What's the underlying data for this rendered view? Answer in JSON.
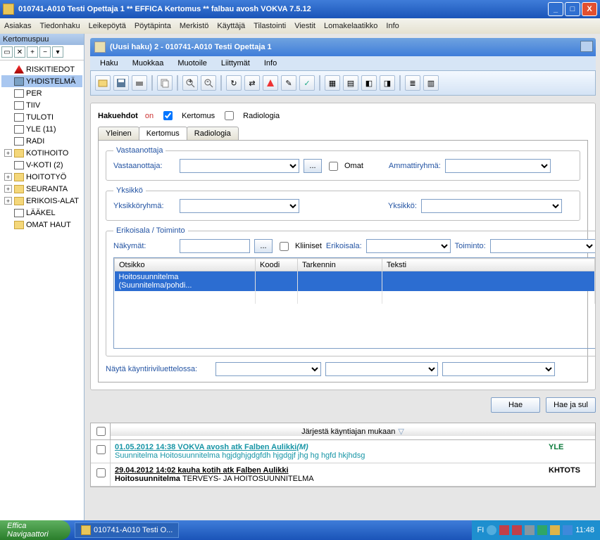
{
  "window_title": "010741-A010 Testi Opettaja 1  ** EFFICA Kertomus **  falbau avosh  VOKVA  7.5.12",
  "main_menu": [
    "Asiakas",
    "Tiedonhaku",
    "Leikepöytä",
    "Pöytäpinta",
    "Merkistö",
    "Käyttäjä",
    "Tilastointi",
    "Viestit",
    "Lomakelaatikko",
    "Info"
  ],
  "tree_header": "Kertomuspuu",
  "tree": [
    {
      "icon": "warn",
      "label": "RISKITIEDOT"
    },
    {
      "icon": "bin",
      "label": "YHDISTELMÄ",
      "selected": true
    },
    {
      "icon": "doc",
      "label": "PER",
      "indent": 1
    },
    {
      "icon": "doc",
      "label": "TIIV",
      "indent": 1
    },
    {
      "icon": "doc",
      "label": "TULOTI",
      "indent": 1
    },
    {
      "icon": "doc",
      "label": "YLE (11)",
      "indent": 1
    },
    {
      "icon": "doc",
      "label": "RADI",
      "indent": 1
    },
    {
      "icon": "fold",
      "label": "KOTIHOITO",
      "exp": true
    },
    {
      "icon": "doc",
      "label": "V-KOTI (2)",
      "indent": 1
    },
    {
      "icon": "fold",
      "label": "HOITOTYÖ",
      "exp": true
    },
    {
      "icon": "fold",
      "label": "SEURANTA",
      "exp": true
    },
    {
      "icon": "fold",
      "label": "ERIKOIS-ALAT",
      "exp": true
    },
    {
      "icon": "doc",
      "label": "LÄÄKEL",
      "indent": 1
    },
    {
      "icon": "fold",
      "label": "OMAT HAUT"
    }
  ],
  "sub_title": "(Uusi haku) 2 - 010741-A010 Testi Opettaja 1",
  "sub_menu": [
    "Haku",
    "Muokkaa",
    "Muotoile",
    "Liittymät",
    "Info"
  ],
  "search_box": {
    "title": "Hakuehdot",
    "on": "on",
    "chk_kertomus": "Kertomus",
    "chk_radiologia": "Radiologia",
    "tabs": [
      "Yleinen",
      "Kertomus",
      "Radiologia"
    ],
    "fs_vastaan": "Vastaanottaja",
    "lab_vastaan": "Vastaanottaja:",
    "lab_omat": "Omat",
    "lab_ammatti": "Ammattiryhmä:",
    "fs_yks": "Yksikkö",
    "lab_yksryh": "Yksikköryhmä:",
    "lab_yks": "Yksikkö:",
    "fs_erik": "Erikoisala / Toiminto",
    "lab_nak": "Näkymät:",
    "lab_kliin": "Kliiniset",
    "lab_erik": "Erikoisala:",
    "lab_toim": "Toiminto:",
    "grid_headers": [
      "Otsikko",
      "Koodi",
      "Tarkennin",
      "Teksti"
    ],
    "grid_row": "Hoitosuunnitelma (Suunnitelma/pohdi...",
    "lab_nayta": "Näytä käyntiriviluettelossa:",
    "btn_hae": "Hae",
    "btn_hae2": "Hae ja sul"
  },
  "results": {
    "sort_label": "Järjestä käyntiajan mukaan",
    "entries": [
      {
        "link": "01.05.2012 14:38 VOKVA avosh atk Falben Aulikki",
        "em": "(M)",
        "sub": "Suunnitelma Hoitosuunnitelma ",
        "subg": "hgjdghjgdgfdh hjgdgjf jhg hg hgfd hkjhdsg",
        "tag": "YLE",
        "tagcolor": "#0a7a3a",
        "linkclass": "link"
      },
      {
        "link": "29.04.2012 14:02 kauha kotih atk Falben Aulikki",
        "sub": "Hoitosuunnitelma ",
        "subg": "TERVEYS- JA HOITOSUUNNITELMA",
        "tag": "KHTOTS",
        "tagcolor": "#000",
        "linkclass": "link2"
      }
    ]
  },
  "taskbar": {
    "start": "Effica Navigaattori",
    "task": "010741-A010 Testi O...",
    "lang": "FI",
    "time": "11:48"
  }
}
